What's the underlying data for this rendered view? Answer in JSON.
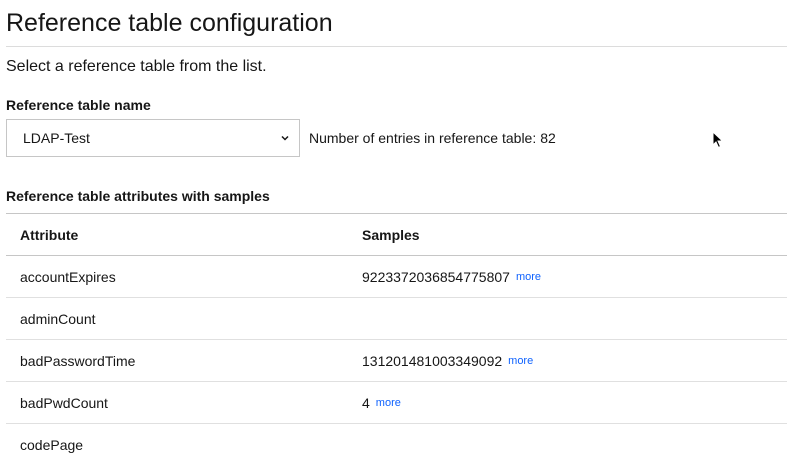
{
  "header": {
    "title": "Reference table configuration",
    "instruction": "Select a reference table from the list."
  },
  "reference_table": {
    "label": "Reference table name",
    "selected": "LDAP-Test",
    "entries_label": "Number of entries in reference table:",
    "entries_count": "82"
  },
  "attributes": {
    "section_label": "Reference table attributes with samples",
    "columns": {
      "attribute": "Attribute",
      "samples": "Samples"
    },
    "rows": [
      {
        "attribute": "accountExpires",
        "sample": "9223372036854775807",
        "more": "more"
      },
      {
        "attribute": "adminCount",
        "sample": "",
        "more": ""
      },
      {
        "attribute": "badPasswordTime",
        "sample": "131201481003349092",
        "more": "more"
      },
      {
        "attribute": "badPwdCount",
        "sample": "4",
        "more": "more"
      },
      {
        "attribute": "codePage",
        "sample": "",
        "more": ""
      }
    ]
  },
  "icons": {
    "dropdown": "chevron-down-icon",
    "pointer": "mouse-cursor-icon"
  },
  "colors": {
    "link": "#0f62fe",
    "text": "#161616",
    "divider": "#e0e0e0"
  }
}
